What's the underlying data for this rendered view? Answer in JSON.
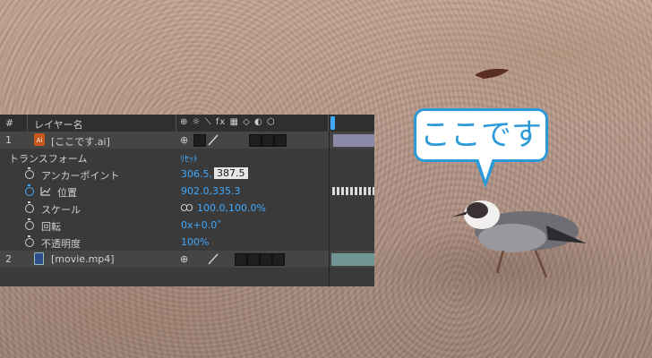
{
  "timeline": {
    "header": {
      "num": "#",
      "layer_name_col": "レイヤー名",
      "switch_icons": "⊕ ☼ ⟍ fx ▦ ◇ ◐ ⬡"
    },
    "layers": [
      {
        "index": "1",
        "name": "[ここです.ai]"
      },
      {
        "index": "2",
        "name": "[movie.mp4]"
      }
    ],
    "transform": {
      "label": "トランスフォーム",
      "reset": "ﾘｾｯﾄ",
      "properties": [
        {
          "label": "アンカーポイント",
          "value_a": "306.5,",
          "value_b": "387.5"
        },
        {
          "label": "位置",
          "value": "902.0,335.3"
        },
        {
          "label": "スケール",
          "value": "100.0,100.0%"
        },
        {
          "label": "回転",
          "value": "0x+0.0˚"
        },
        {
          "label": "不透明度",
          "value": "100%"
        }
      ]
    },
    "colors": {
      "value_blue": "#3fa9ff",
      "panel_bg": "#3a3a3a",
      "layer1_bar": "#8a8aa8",
      "layer2_bar": "#6f9595"
    }
  },
  "bubble": {
    "text": "ここです"
  }
}
